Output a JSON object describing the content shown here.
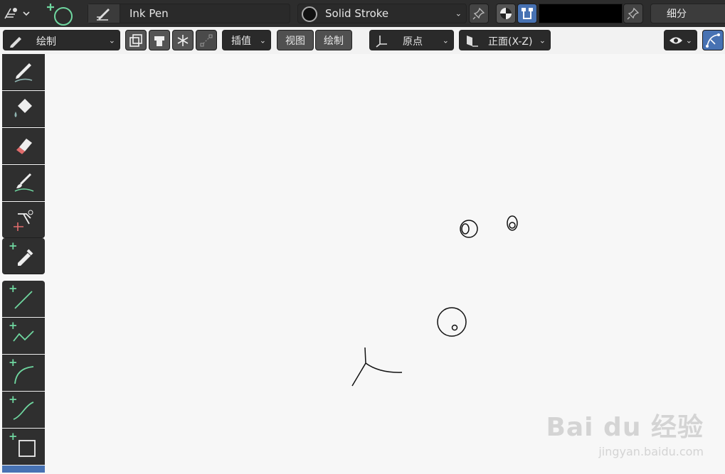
{
  "topbar": {
    "brush_name": "Ink Pen",
    "material_name": "Solid Stroke",
    "subdivide_label": "细分",
    "color_swatch": "#000000"
  },
  "toolbar": {
    "mode_label": "绘制",
    "interp_label": "插值",
    "view_label": "视图",
    "draw_menu_label": "绘制",
    "origin_label": "原点",
    "orientation_label": "正面(X-Z)"
  },
  "tools": [
    {
      "name": "draw-tool",
      "icon": "pencil-icon"
    },
    {
      "name": "fill-tool",
      "icon": "bucket-icon"
    },
    {
      "name": "erase-tool",
      "icon": "eraser-icon"
    },
    {
      "name": "tint-tool",
      "icon": "brush-icon"
    },
    {
      "name": "cutter-tool",
      "icon": "scissors-icon"
    },
    {
      "name": "eyedropper-tool",
      "icon": "eyedropper-icon"
    },
    {
      "name": "line-tool",
      "icon": "line-icon"
    },
    {
      "name": "polyline-tool",
      "icon": "polyline-icon"
    },
    {
      "name": "arc-tool",
      "icon": "arc-icon"
    },
    {
      "name": "curve-tool",
      "icon": "curve-icon"
    },
    {
      "name": "box-tool",
      "icon": "box-icon"
    }
  ],
  "watermark": {
    "brand": "Bai du 经验",
    "url": "jingyan.baidu.com"
  },
  "colors": {
    "accent_green": "#6fd7a0",
    "active_blue": "#4772b3",
    "canvas_bg": "#f7f7f7"
  }
}
